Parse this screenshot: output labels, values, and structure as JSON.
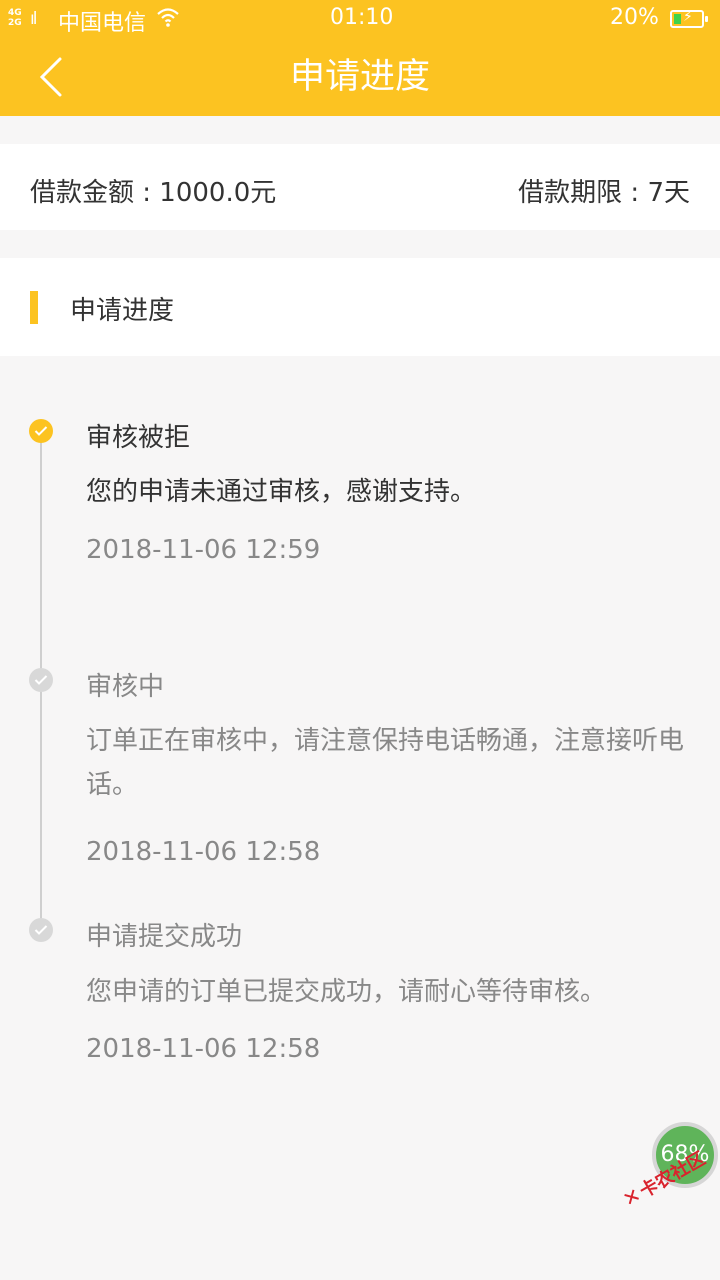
{
  "status_bar": {
    "network": "4G\n2G",
    "signal": "ıl",
    "carrier": "中国电信",
    "time": "01:10",
    "battery": "20%"
  },
  "nav": {
    "title": "申请进度"
  },
  "summary": {
    "amount": "借款金额 : 1000.0元",
    "term": "借款期限 : 7天"
  },
  "section": {
    "label": "申请进度"
  },
  "steps": [
    {
      "title": "审核被拒",
      "desc": "您的申请未通过审核，感谢支持。",
      "time": "2018-11-06 12:59"
    },
    {
      "title": "审核中",
      "desc": "订单正在审核中，请注意保持电话畅通，注意接听电话。",
      "time": "2018-11-06 12:58"
    },
    {
      "title": "申请提交成功",
      "desc": "您申请的订单已提交成功，请耐心等待审核。",
      "time": "2018-11-06 12:58"
    }
  ],
  "floating": {
    "percent": "68%"
  },
  "watermark": {
    "text": "卡农社区"
  },
  "colors": {
    "accent": "#fcc321",
    "inactive_dot": "#d8d8d8",
    "muted_text": "#888888"
  }
}
